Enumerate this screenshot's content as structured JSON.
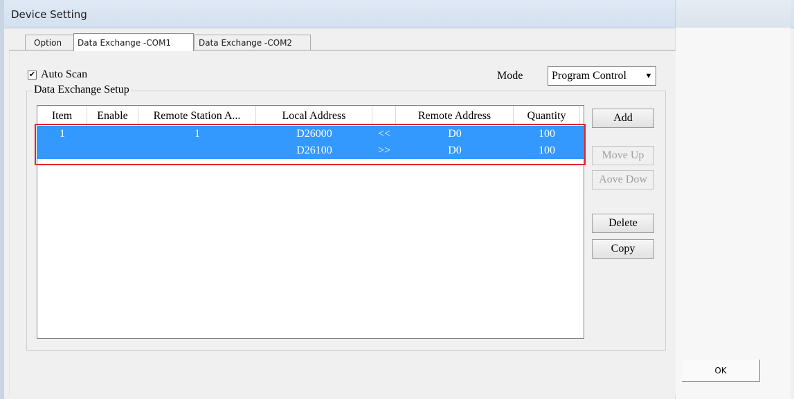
{
  "window": {
    "title": "Device Setting"
  },
  "tabs": [
    {
      "label": "Option"
    },
    {
      "label": "Data Exchange -COM1",
      "active": true
    },
    {
      "label": "Data Exchange -COM2"
    }
  ],
  "auto_scan": {
    "label": "Auto Scan",
    "checked": true,
    "check_glyph": "✔"
  },
  "mode": {
    "label": "Mode",
    "value": "Program Control",
    "arrow_glyph": "▼"
  },
  "group": {
    "title": "Data Exchange Setup"
  },
  "table": {
    "columns": [
      "Item",
      "Enable",
      "Remote Station A...",
      "Local Address",
      "",
      "Remote Address",
      "Quantity"
    ],
    "rows": [
      {
        "item": "1",
        "enable": "",
        "remote_station": "1",
        "local_address": "D26000",
        "direction": "<<",
        "remote_address": "D0",
        "quantity": "100"
      },
      {
        "item": "",
        "enable": "",
        "remote_station": "",
        "local_address": "D26100",
        "direction": ">>",
        "remote_address": "D0",
        "quantity": "100"
      }
    ],
    "selected_color": "#3399ff",
    "highlight_color": "#e0272b"
  },
  "buttons": {
    "add": "Add",
    "move_up": "Move Up",
    "move_down": "Aove Dow",
    "delete": "Delete",
    "copy": "Copy",
    "ok": "OK"
  }
}
